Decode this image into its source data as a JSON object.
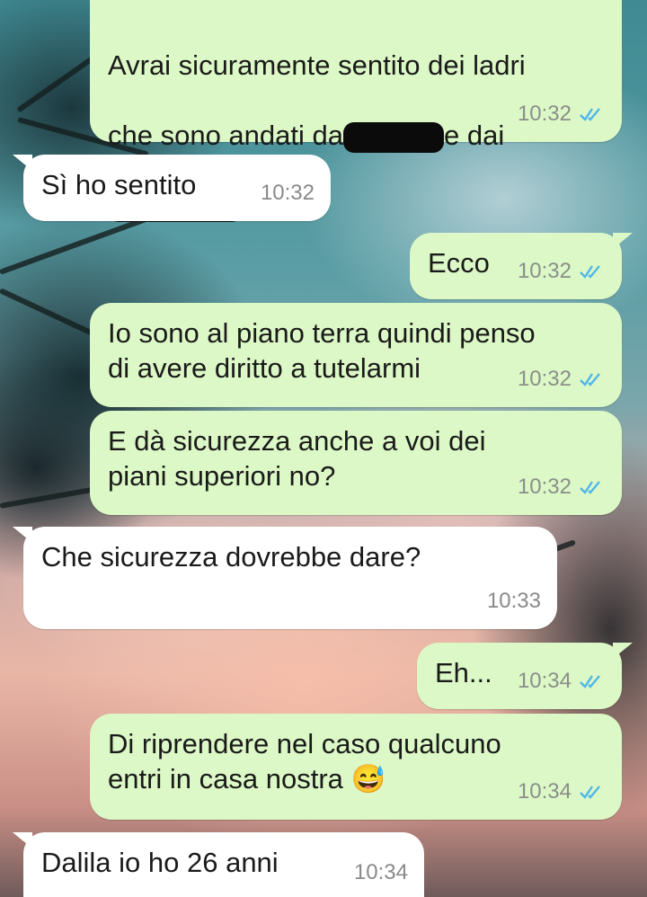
{
  "messages": [
    {
      "dir": "out",
      "lines": [
        "Avrai sicuramente sentito dei ladri",
        "che sono andati da",
        "e dai"
      ],
      "time": "10:32",
      "ticks": "read"
    },
    {
      "dir": "in",
      "text": "Sì ho sentito",
      "time": "10:32"
    },
    {
      "dir": "out",
      "text": "Ecco",
      "time": "10:32",
      "ticks": "read"
    },
    {
      "dir": "out",
      "text": "Io sono al piano terra quindi penso\ndi avere diritto a tutelarmi",
      "time": "10:32",
      "ticks": "read"
    },
    {
      "dir": "out",
      "text": "E dà sicurezza anche a voi dei\npiani superiori no?",
      "time": "10:32",
      "ticks": "read"
    },
    {
      "dir": "in",
      "text": "Che sicurezza dovrebbe dare?",
      "time": "10:33"
    },
    {
      "dir": "out",
      "text": "Eh...",
      "time": "10:34",
      "ticks": "read"
    },
    {
      "dir": "out",
      "text": "Di riprendere nel caso qualcuno\nentri in casa nostra",
      "emoji": "😅",
      "time": "10:34",
      "ticks": "read"
    },
    {
      "dir": "in",
      "text": "Dalila io ho 26 anni",
      "time": "10:34"
    }
  ],
  "colors": {
    "outgoing": "#dcf8c6",
    "incoming": "#ffffff",
    "read_ticks": "#4fb6ec"
  },
  "icons": {
    "read": "double-check-icon"
  }
}
